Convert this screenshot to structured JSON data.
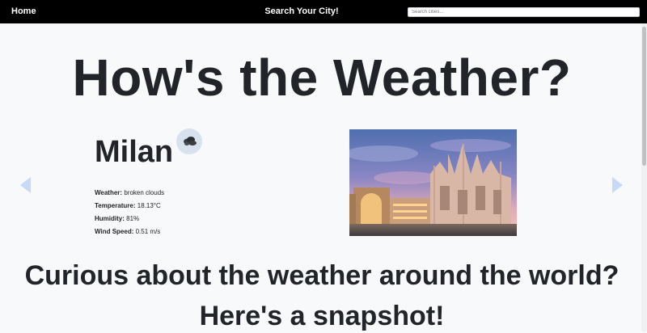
{
  "nav": {
    "home": "Home",
    "center_title": "Search Your City!",
    "search_placeholder": "Search cities..."
  },
  "hero": {
    "title": "How's the Weather?"
  },
  "current_city": {
    "name": "Milan",
    "icon": "broken-clouds-icon",
    "details": [
      {
        "label": "Weather:",
        "value": "broken clouds"
      },
      {
        "label": "Temperature:",
        "value": "18.13°C"
      },
      {
        "label": "Humidity:",
        "value": "81%"
      },
      {
        "label": "Wind Speed:",
        "value": "0.51 m/s"
      }
    ],
    "photo": "milan-cathedral-photo"
  },
  "snapshot": {
    "line1": "Curious about the weather around the world?",
    "line2": "Here's a snapshot!"
  },
  "colors": {
    "navbar_bg": "#000000",
    "page_bg": "#f8f9fa",
    "arrow": "#c6daf5",
    "text": "#212529"
  }
}
